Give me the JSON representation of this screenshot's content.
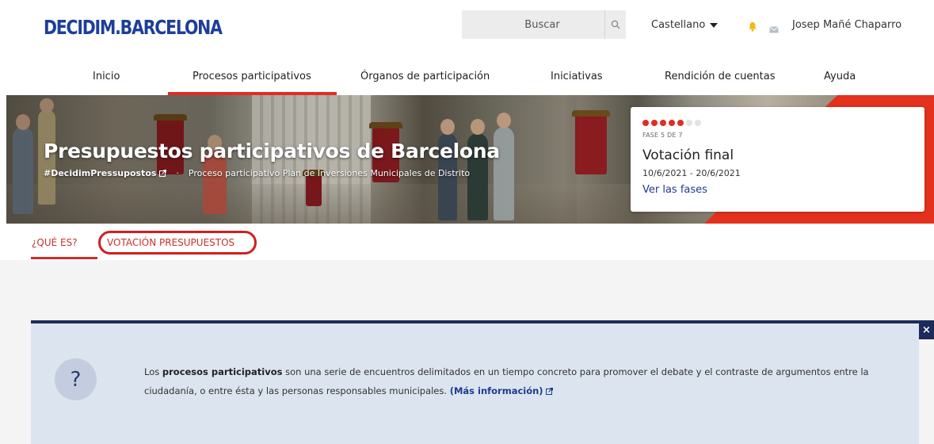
{
  "header": {
    "logo": "DECIDIM.BARCELONA",
    "search_placeholder": "Buscar",
    "language": "Castellano",
    "user_name": "Josep Mañé Chaparro"
  },
  "nav": {
    "items": [
      {
        "label": "Inicio",
        "active": false
      },
      {
        "label": "Procesos participativos",
        "active": true
      },
      {
        "label": "Órganos de participación",
        "active": false
      },
      {
        "label": "Iniciativas",
        "active": false
      },
      {
        "label": "Rendición de cuentas",
        "active": false
      },
      {
        "label": "Ayuda",
        "active": false
      }
    ]
  },
  "hero": {
    "title": "Presupuestos participativos de Barcelona",
    "hashtag": "#DecidimPressupostos",
    "separator": "·",
    "subtitle": "Proceso participativo Plan de Inversiones Municipales de Distrito"
  },
  "phase": {
    "label": "FASE 5 DE 7",
    "current": 5,
    "total": 7,
    "name": "Votación final",
    "dates": "10/6/2021 - 20/6/2021",
    "link": "Ver las fases"
  },
  "subtabs": {
    "items": [
      {
        "label": "¿QUÉ ES?",
        "active": true
      },
      {
        "label": "VOTACIÓN PRESUPUESTOS",
        "active": false,
        "highlighted": true
      }
    ]
  },
  "info": {
    "close": "×",
    "icon": "?",
    "text_before": "Los ",
    "bold": "procesos participativos",
    "text_after": " son una serie de encuentros delimitados en un tiempo concreto para promover el debate y el contraste de argumentos entre la ciudadanía, o entre ésta y las personas responsables municipales. ",
    "link": "(Más información)"
  },
  "colors": {
    "brand_blue": "#1d3e9a",
    "accent_red": "#e02d26",
    "navy": "#1e2a5a",
    "info_bg": "#dce4ef"
  }
}
